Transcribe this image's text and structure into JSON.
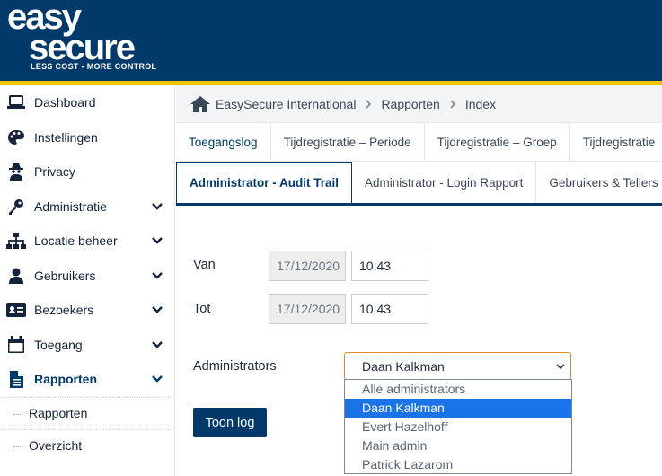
{
  "brand": {
    "line1": "easy",
    "line2": "secure",
    "tagline": "LESS COST • MORE CONTROL",
    "header_color": "#003a6b",
    "accent_color": "#f3c400"
  },
  "sidebar": {
    "items": [
      {
        "label": "Dashboard",
        "icon": "laptop-icon"
      },
      {
        "label": "Instellingen",
        "icon": "palette-icon"
      },
      {
        "label": "Privacy",
        "icon": "user-secret-icon"
      },
      {
        "label": "Administratie",
        "icon": "key-icon"
      },
      {
        "label": "Locatie beheer",
        "icon": "sitemap-icon"
      },
      {
        "label": "Gebruikers",
        "icon": "user-icon"
      },
      {
        "label": "Bezoekers",
        "icon": "id-card-icon"
      },
      {
        "label": "Toegang",
        "icon": "calendar-icon"
      },
      {
        "label": "Rapporten",
        "icon": "file-icon"
      }
    ],
    "subitems": [
      {
        "label": "Rapporten"
      },
      {
        "label": "Overzicht"
      }
    ]
  },
  "breadcrumb": {
    "home": "EasySecure International",
    "level2": "Rapporten",
    "level3": "Index"
  },
  "tabs_row1": [
    {
      "label": "Toegangslog"
    },
    {
      "label": "Tijdregistratie – Periode"
    },
    {
      "label": "Tijdregistratie – Groep"
    },
    {
      "label": "Tijdregistratie"
    }
  ],
  "tabs_row2": [
    {
      "label": "Administrator - Audit Trail"
    },
    {
      "label": "Administrator - Login Rapport"
    },
    {
      "label": "Gebruikers & Tellers"
    }
  ],
  "form": {
    "van_label": "Van",
    "van_date": "17/12/2020",
    "van_time": "10:43",
    "tot_label": "Tot",
    "tot_date": "17/12/2020",
    "tot_time": "10:43",
    "admins_label": "Administrators",
    "admins_selected": "Daan Kalkman",
    "admins_options": [
      "Alle administrators",
      "Daan Kalkman",
      "Evert Hazelhoff",
      "Main admin",
      "Patrick Lazarom"
    ],
    "submit_label": "Toon log"
  }
}
